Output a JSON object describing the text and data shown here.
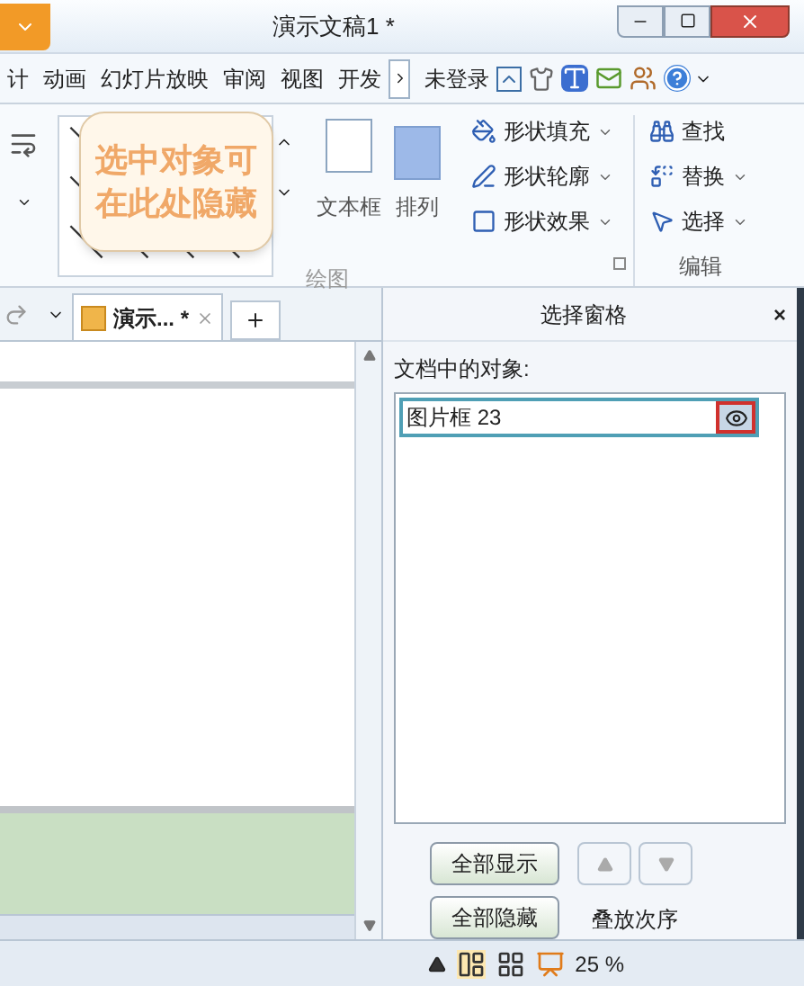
{
  "window": {
    "title": "演示文稿1 *"
  },
  "menu_tabs": [
    {
      "label": "计",
      "selected": false
    },
    {
      "label": "动画",
      "selected": false
    },
    {
      "label": "幻灯片放映",
      "selected": false
    },
    {
      "label": "审阅",
      "selected": false
    },
    {
      "label": "视图",
      "selected": false
    },
    {
      "label": "开发",
      "selected": false
    }
  ],
  "account": "未登录",
  "ribbon": {
    "large_buttons": [
      "文本框",
      "排列"
    ],
    "shape_format": [
      "形状填充",
      "形状轮廓",
      "形状效果"
    ],
    "edit": [
      "查找",
      "替换",
      "选择"
    ],
    "groups": [
      "绘图",
      "编辑"
    ]
  },
  "doc_tabs": [
    {
      "label": "演示... *",
      "selected": true
    }
  ],
  "pane": {
    "title": "选择窗格",
    "close": "×",
    "label": "文档中的对象:",
    "objects": [
      {
        "name": "图片框 23",
        "visible": true,
        "selected": true
      }
    ],
    "buttons": [
      "全部显示",
      "全部隐藏"
    ],
    "order_label": "叠放次序"
  },
  "status": {
    "zoom": "25 %"
  },
  "callout": [
    "选中对象可",
    "在此处隐藏"
  ]
}
